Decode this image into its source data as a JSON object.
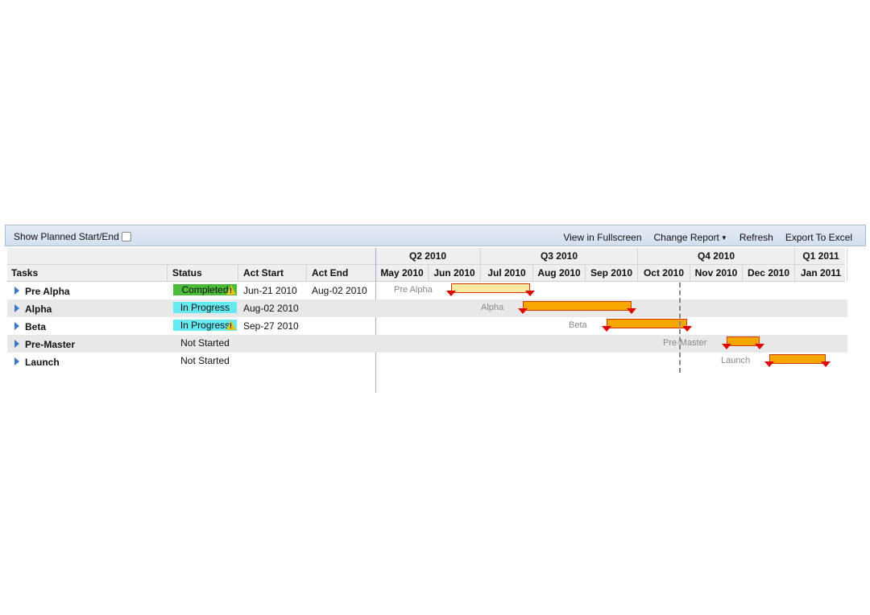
{
  "toolbar": {
    "show_planned_label": "Show Planned Start/End",
    "view_fullscreen": "View in Fullscreen",
    "change_report": "Change Report",
    "refresh": "Refresh",
    "export_excel": "Export To Excel"
  },
  "columns": {
    "tasks": "Tasks",
    "status": "Status",
    "act_start": "Act Start",
    "act_end": "Act End"
  },
  "quarters": [
    "Q2 2010",
    "Q3 2010",
    "Q4 2010",
    "Q1 2011"
  ],
  "months": [
    "May 2010",
    "Jun 2010",
    "Jul 2010",
    "Aug 2010",
    "Sep 2010",
    "Oct 2010",
    "Nov 2010",
    "Dec 2010",
    "Jan 2011"
  ],
  "rows": [
    {
      "name": "Pre Alpha",
      "status": "Completed",
      "status_style": "completed",
      "warning": true,
      "act_start": "Jun-21 2010",
      "act_end": "Aug-02 2010",
      "gantt_label": "Pre Alpha"
    },
    {
      "name": "Alpha",
      "status": "In Progress",
      "status_style": "inprogress",
      "warning": false,
      "act_start": "Aug-02 2010",
      "act_end": "",
      "gantt_label": "Alpha"
    },
    {
      "name": "Beta",
      "status": "In Progress",
      "status_style": "inprogress",
      "warning": true,
      "act_start": "Sep-27 2010",
      "act_end": "",
      "gantt_label": "Beta"
    },
    {
      "name": "Pre-Master",
      "status": "Not Started",
      "status_style": "notstarted",
      "warning": false,
      "act_start": "",
      "act_end": "",
      "gantt_label": "Pre-Master"
    },
    {
      "name": "Launch",
      "status": "Not Started",
      "status_style": "notstarted",
      "warning": false,
      "act_start": "",
      "act_end": "",
      "gantt_label": "Launch"
    }
  ],
  "colors": {
    "completed": "#4dbb3a",
    "in_progress": "#66eaf0",
    "bar_complete": "#fbe9a6",
    "bar_active": "#f7a800",
    "bar_border": "#d43a00",
    "marker": "#e00000"
  }
}
